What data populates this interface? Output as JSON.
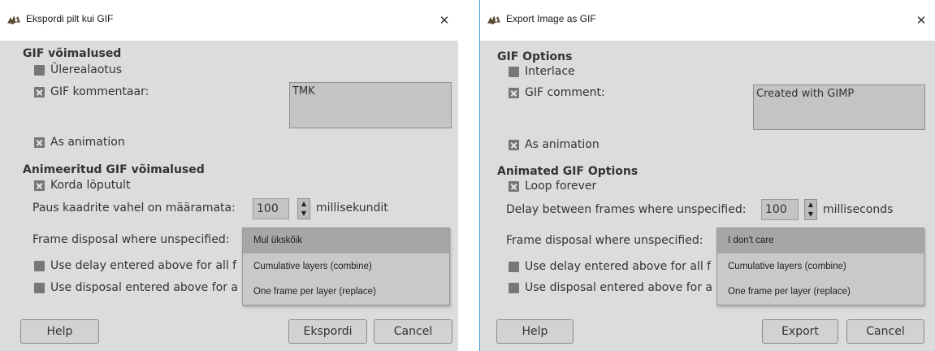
{
  "dialogs": [
    {
      "title": "Ekspordi pilt kui GIF",
      "close_glyph": "✕",
      "gif_options": {
        "heading": "GIF võimalused",
        "interlace": {
          "label": "Ülerealaotus",
          "checked": false
        },
        "comment": {
          "label": "GIF kommentaar:",
          "checked": true,
          "value": "TMK"
        },
        "as_animation": {
          "label": "As animation",
          "checked": true
        }
      },
      "anim_options": {
        "heading": "Animeeritud GIF võimalused",
        "loop": {
          "label": "Korda lõputult",
          "checked": true
        },
        "delay": {
          "label": "Paus kaadrite vahel on määramata:",
          "value": "100",
          "unit": "millisekundit"
        },
        "disposal": {
          "label": "Frame disposal where unspecified:",
          "options": [
            "Mul ükskõik",
            "Cumulative layers (combine)",
            "One frame per layer (replace)"
          ],
          "selected_index": 0
        },
        "use_delay": {
          "label": "Use delay entered above for all f",
          "checked": false
        },
        "use_disposal": {
          "label": "Use disposal entered above for a",
          "checked": false
        }
      },
      "buttons": {
        "help": "Help",
        "export": "Ekspordi",
        "cancel": "Cancel"
      }
    },
    {
      "title": "Export Image as GIF",
      "close_glyph": "✕",
      "gif_options": {
        "heading": "GIF Options",
        "interlace": {
          "label": "Interlace",
          "checked": false
        },
        "comment": {
          "label": "GIF comment:",
          "checked": true,
          "value": "Created with GIMP"
        },
        "as_animation": {
          "label": "As animation",
          "checked": true
        }
      },
      "anim_options": {
        "heading": "Animated GIF Options",
        "loop": {
          "label": "Loop forever",
          "checked": true
        },
        "delay": {
          "label": "Delay between frames where unspecified:",
          "value": "100",
          "unit": "milliseconds"
        },
        "disposal": {
          "label": "Frame disposal where unspecified:",
          "options": [
            "I don't care",
            "Cumulative layers (combine)",
            "One frame per layer (replace)"
          ],
          "selected_index": 0
        },
        "use_delay": {
          "label": "Use delay entered above for all f",
          "checked": false
        },
        "use_disposal": {
          "label": "Use disposal entered above for a",
          "checked": false
        }
      },
      "buttons": {
        "help": "Help",
        "export": "Export",
        "cancel": "Cancel"
      }
    }
  ],
  "icons": {
    "app": "gimp-wilber-icon",
    "close": "close-icon",
    "checkbox_on": "checkbox-checked-icon",
    "checkbox_off": "checkbox-unchecked-icon",
    "spin": "spin-arrows-icon"
  },
  "colors": {
    "dialog_bg": "#dcdcdc",
    "titlebar_bg": "#ffffff",
    "field_bg": "#c4c4c4",
    "selected_item": "#a6a6a6",
    "window_border": "#4a9ad4"
  }
}
